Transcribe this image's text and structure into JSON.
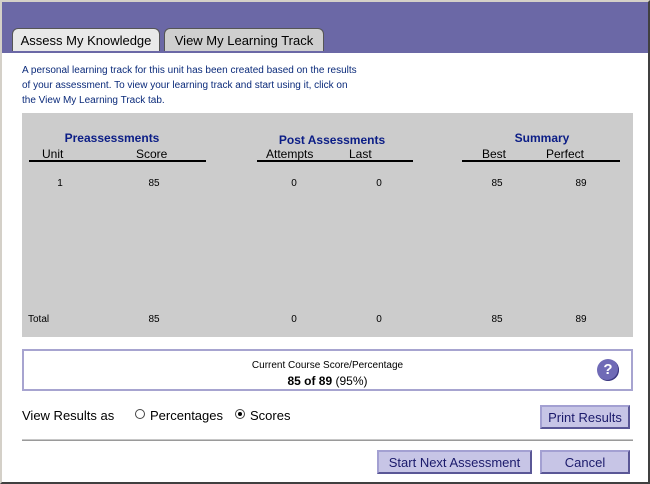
{
  "tabs": [
    {
      "label": "Assess My Knowledge",
      "active": true
    },
    {
      "label": "View My Learning Track",
      "active": false
    }
  ],
  "intro": {
    "line1": "A personal learning track for this unit has been created based on the results",
    "line2": "of your assessment.  To view your learning track and start using it, click on",
    "line3": "the View My Learning Track tab."
  },
  "table": {
    "groups": {
      "pre": "Preassessments",
      "post": "Post Assessments",
      "summary": "Summary"
    },
    "columns": [
      "Unit",
      "Score",
      "Attempts",
      "Last",
      "Best",
      "Perfect"
    ],
    "row": {
      "unit": "1",
      "score": "85",
      "attempts": "0",
      "last": "0",
      "best": "85",
      "perfect": "89"
    },
    "total": {
      "label": "Total",
      "score": "85",
      "attempts": "0",
      "last": "0",
      "best": "85",
      "perfect": "89"
    }
  },
  "course_score": {
    "label": "Current Course Score/Percentage",
    "value": "85 of 89",
    "percent": "(95%)"
  },
  "view_results": {
    "label": "View Results as",
    "options": [
      "Percentages",
      "Scores"
    ],
    "selected": "Scores"
  },
  "buttons": {
    "print": "Print Results",
    "start_next": "Start Next Assessment",
    "cancel": "Cancel"
  },
  "colors": {
    "header": "#6b68a6",
    "heading_blue": "#0b1d86",
    "grid_bg": "#cccccc"
  },
  "icons": {
    "help": "?"
  }
}
